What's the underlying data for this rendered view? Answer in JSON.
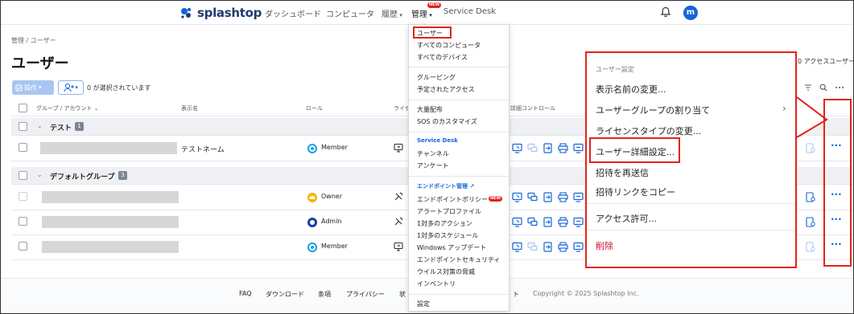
{
  "nav": {
    "logo_text": "splashtop",
    "items": [
      {
        "label": "ダッシュボード"
      },
      {
        "label": "コンピュータ"
      },
      {
        "label": "履歴"
      },
      {
        "label": "管理"
      },
      {
        "label": "Service Desk"
      }
    ],
    "new_badge": "NEW",
    "avatar_initial": "m"
  },
  "page": {
    "breadcrumb": "管理 / ユーザー",
    "title": "ユーザー",
    "right_link": "0 アクセスユーザー"
  },
  "toolbar": {
    "ops_label": "操作",
    "selected_text": "0 が選択されています"
  },
  "table": {
    "headers": {
      "group_account": "グループ / アカウント",
      "display_name": "表示名",
      "role": "ロール",
      "license": "ライセ",
      "detail_control": "詳細コントロール"
    },
    "groups": [
      {
        "name": "テスト",
        "count": "1"
      },
      {
        "name": "デフォルトグループ",
        "count": "3"
      }
    ],
    "rows": [
      {
        "display_name": "テストネーム",
        "role": "Member"
      },
      {
        "display_name": "",
        "role": "Owner"
      },
      {
        "display_name": "",
        "role": "Admin"
      },
      {
        "display_name": "",
        "role": "Member"
      }
    ]
  },
  "mgmt_menu": {
    "items_a": [
      "ユーザー",
      "すべてのコンピュータ",
      "すべてのデバイス"
    ],
    "items_b": [
      "グルーピング",
      "予定されたアクセス"
    ],
    "items_c": [
      "大量配布",
      "SOS のカスタマイズ"
    ],
    "service_desk_head": "Service Desk",
    "items_d": [
      "チャンネル",
      "アンケート"
    ],
    "endpoint_head": "エンドポイント管理",
    "items_e": [
      "エンドポイントポリシー",
      "アラートプロファイル",
      "1対多のアクション",
      "1対多のスケジュール",
      "Windows アップデート",
      "エンドポイントセキュリティ",
      "ウイルス対策の脅威",
      "インベントリ"
    ],
    "settings": "設定"
  },
  "context_menu": {
    "head": "ユーザー設定",
    "items": [
      "表示名前の変更...",
      "ユーザーグループの割り当て",
      "ライセンスタイプの変更...",
      "ユーザー詳細設定...",
      "招待を再送信",
      "招待リンクをコピー",
      "アクセス許可...",
      "削除"
    ]
  },
  "footer": {
    "links": [
      "FAQ",
      "ダウンロード",
      "条項",
      "プライバシー",
      "状",
      "ト"
    ],
    "copyright": "Copyright © 2025 Splashtop Inc."
  },
  "colors": {
    "accent": "#1565d8",
    "highlight": "#e2231a",
    "brand_dark": "#1e3c6e"
  }
}
